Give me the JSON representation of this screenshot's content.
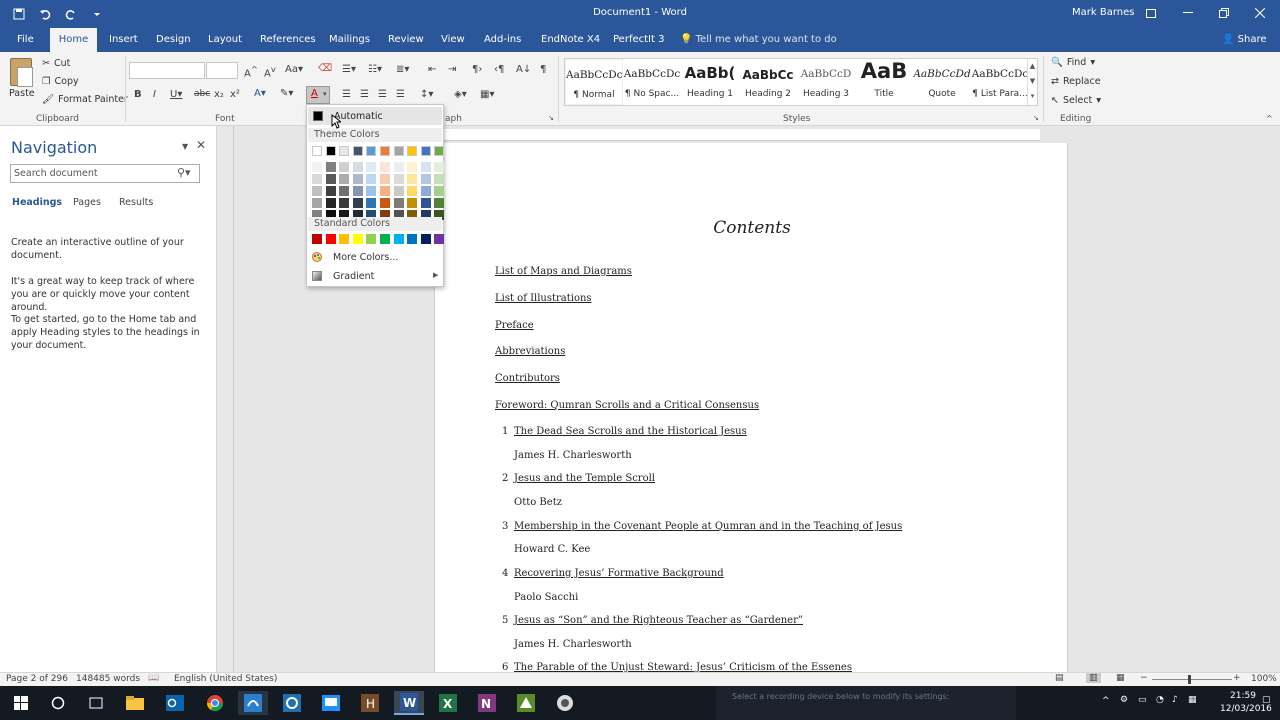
{
  "window": {
    "title": "Document1 - Word",
    "user": "Mark Barnes"
  },
  "tabs": [
    "File",
    "Home",
    "Insert",
    "Design",
    "Layout",
    "References",
    "Mailings",
    "Review",
    "View",
    "Add-ins",
    "EndNote X4",
    "PerfectIt 3"
  ],
  "tell_me": "Tell me what you want to do",
  "share": "Share",
  "clipboard": {
    "paste": "Paste",
    "cut": "Cut",
    "copy": "Copy",
    "format_painter": "Format Painter",
    "label": "Clipboard"
  },
  "groups": {
    "font": "Font",
    "paragraph": "aph",
    "styles": "Styles",
    "editing": "Editing"
  },
  "styles": [
    {
      "preview": "AaBbCcDc",
      "label": "¶ Normal"
    },
    {
      "preview": "AaBbCcDc",
      "label": "¶ No Spac..."
    },
    {
      "preview": "AaBb(",
      "label": "Heading 1"
    },
    {
      "preview": "AaBbCc",
      "label": "Heading 2"
    },
    {
      "preview": "AaBbCcD",
      "label": "Heading 3"
    },
    {
      "preview": "AaB",
      "label": "Title"
    },
    {
      "preview": "AaBbCcDd",
      "label": "Quote"
    },
    {
      "preview": "AaBbCcDc",
      "label": "¶ List Para..."
    }
  ],
  "editing": {
    "find": "Find",
    "replace": "Replace",
    "select": "Select"
  },
  "navigation": {
    "title": "Navigation",
    "search_placeholder": "Search document",
    "tabs": [
      "Headings",
      "Pages",
      "Results"
    ],
    "p1": "Create an interactive outline of your document.",
    "p2": "It's a great way to keep track of where you are or quickly move your content around.",
    "p3": "To get started, go to the Home tab and apply Heading styles to the headings in your document."
  },
  "color_menu": {
    "automatic": "Automatic",
    "theme_colors": "Theme Colors",
    "standard_colors": "Standard Colors",
    "more_colors": "More Colors...",
    "gradient": "Gradient",
    "theme_base": [
      "#ffffff",
      "#000000",
      "#e7e6e6",
      "#44546a",
      "#5b9bd5",
      "#ed7d31",
      "#a5a5a5",
      "#ffc000",
      "#4472c4",
      "#70ad47"
    ],
    "theme_shades": [
      [
        "#f2f2f2",
        "#7f7f7f",
        "#d0cece",
        "#d6dce4",
        "#deebf6",
        "#fbe5d5",
        "#ededed",
        "#fff2cc",
        "#d9e2f3",
        "#e2efd9"
      ],
      [
        "#d8d8d8",
        "#595959",
        "#aeabab",
        "#adb9ca",
        "#bdd7ee",
        "#f7cbac",
        "#dbdbdb",
        "#fee599",
        "#b4c6e7",
        "#c5e0b3"
      ],
      [
        "#bfbfbf",
        "#3f3f3f",
        "#757070",
        "#8496b0",
        "#9cc3e5",
        "#f4b183",
        "#c9c9c9",
        "#ffd965",
        "#8eaadb",
        "#a8d08d"
      ],
      [
        "#a5a5a5",
        "#262626",
        "#3a3838",
        "#323f4f",
        "#2e75b5",
        "#c55a11",
        "#7b7b7b",
        "#bf9000",
        "#2f5496",
        "#538135"
      ],
      [
        "#7f7f7f",
        "#0c0c0c",
        "#171616",
        "#222a35",
        "#1f4e79",
        "#833c0b",
        "#525252",
        "#7f6000",
        "#1f3864",
        "#375623"
      ]
    ],
    "standard": [
      "#c00000",
      "#ff0000",
      "#ffc000",
      "#ffff00",
      "#92d050",
      "#00b050",
      "#00b0f0",
      "#0070c0",
      "#002060",
      "#7030a0"
    ]
  },
  "document": {
    "heading": "Contents",
    "top_entries": [
      "List of Maps and Diagrams",
      "List of Illustrations",
      "Preface",
      "Abbreviations",
      "Contributors",
      "Foreword: Qumran Scrolls and a Critical Consensus"
    ],
    "chapters": [
      {
        "num": "1",
        "title": "The Dead Sea Scrolls and the Historical Jesus",
        "author": "James H. Charlesworth"
      },
      {
        "num": "2",
        "title": "Jesus and the Temple Scroll",
        "author": "Otto Betz"
      },
      {
        "num": "3",
        "title": "Membership in the Covenant People at Qumran and in the Teaching of Jesus",
        "author": "Howard C. Kee"
      },
      {
        "num": "4",
        "title": "Recovering Jesus’ Formative Background",
        "author": "Paolo Sacchi"
      },
      {
        "num": "5",
        "title": "Jesus as “Son” and the Righteous Teacher as “Gardener”",
        "author": "James H. Charlesworth"
      },
      {
        "num": "6",
        "title": "The Parable of the Unjust Steward: Jesus’ Criticism of the Essenes",
        "author": ""
      }
    ]
  },
  "status": {
    "page": "Page 2 of 296",
    "words": "148485 words",
    "language": "English (United States)",
    "zoom": "100%"
  },
  "taskbar": {
    "time": "21:59",
    "date": "12/03/2016",
    "notice": "Select a recording device below to modify its settings:"
  }
}
